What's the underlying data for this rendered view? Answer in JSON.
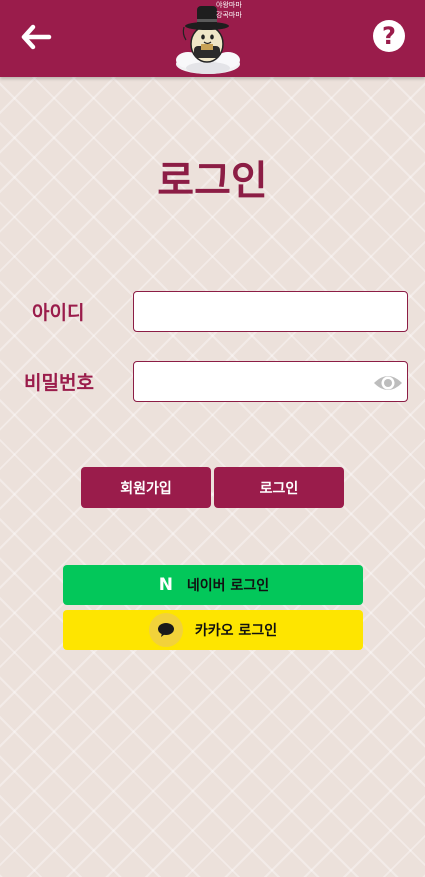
{
  "header": {
    "back_icon": "arrow-left-icon",
    "help_label": "?",
    "logo_text_line1": "야왕마마",
    "logo_text_line2": "강곡마마"
  },
  "main": {
    "title": "로그인",
    "id_label": "아이디",
    "id_value": "",
    "password_label": "비밀번호",
    "password_value": "",
    "toggle_visibility_icon": "eye-icon"
  },
  "actions": {
    "signup_label": "회원가입",
    "login_label": "로그인"
  },
  "social": {
    "naver_label": "네이버 로그인",
    "naver_icon_letter": "N",
    "kakao_label": "카카오 로그인"
  },
  "colors": {
    "brand": "#9a1c4b",
    "naver": "#03c75a",
    "kakao": "#fee500"
  }
}
